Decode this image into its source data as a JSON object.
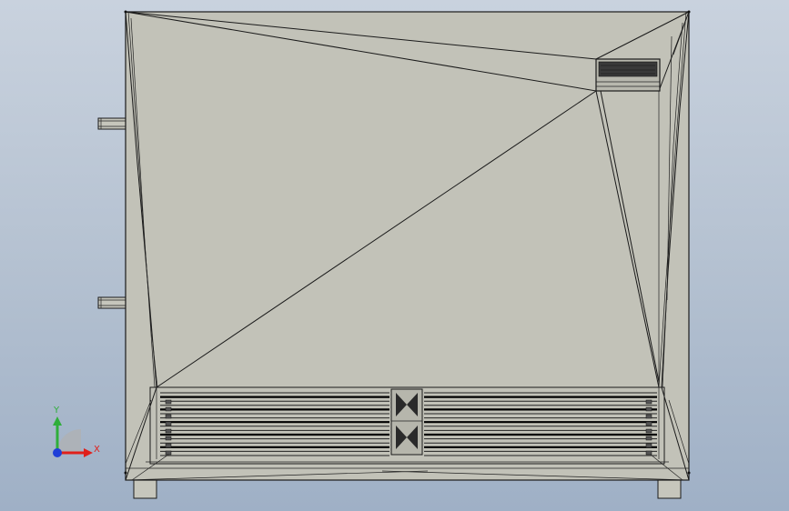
{
  "axis_triad": {
    "y_label": "Y",
    "x_label": "X",
    "y_color": "#2fae3a",
    "x_color": "#e0201b",
    "z_color": "#1f3fd8"
  },
  "model": {
    "face_color": "#c2c2b8",
    "edge_color": "#1a1a1a"
  },
  "viewport": {
    "background_top": "#c9d2de",
    "background_bottom": "#9fb0c6"
  }
}
